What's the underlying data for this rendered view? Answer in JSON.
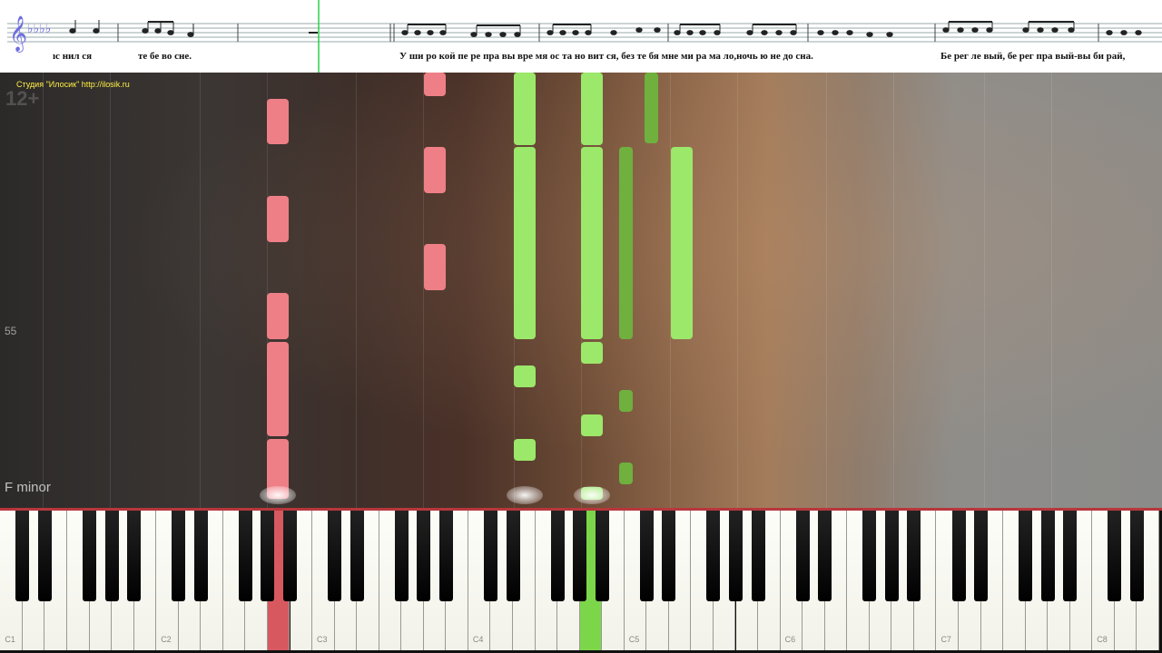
{
  "score": {
    "lyrics_a": "ıс нил  ся",
    "lyrics_b": "те бе во  сне.",
    "lyrics_c": "У  ши ро кой пе ре пра вы вре мя ос та но   вит  ся, без те бя мне ми ра ма  ло,ночь ю не до  сна.",
    "lyrics_d": "Бе рег  ле  вый, бе рег пра вый-вы би  рай,"
  },
  "overlay": {
    "studio": "Студия \"Илосик\" http://ilosik.ru",
    "age": "12+",
    "tempo": "55",
    "key": "F minor"
  },
  "keyboard": {
    "octave_labels": [
      "C1",
      "C2",
      "C3",
      "C4",
      "C5",
      "C6",
      "C7",
      "C8"
    ],
    "pressed_pink": "C3 region",
    "pressed_green": "D4"
  },
  "colors": {
    "left_hand": "#ef7f86",
    "right_hand": "#9be86a",
    "right_hand_dark": "#6fb03e",
    "current_line": "#b7373c"
  }
}
